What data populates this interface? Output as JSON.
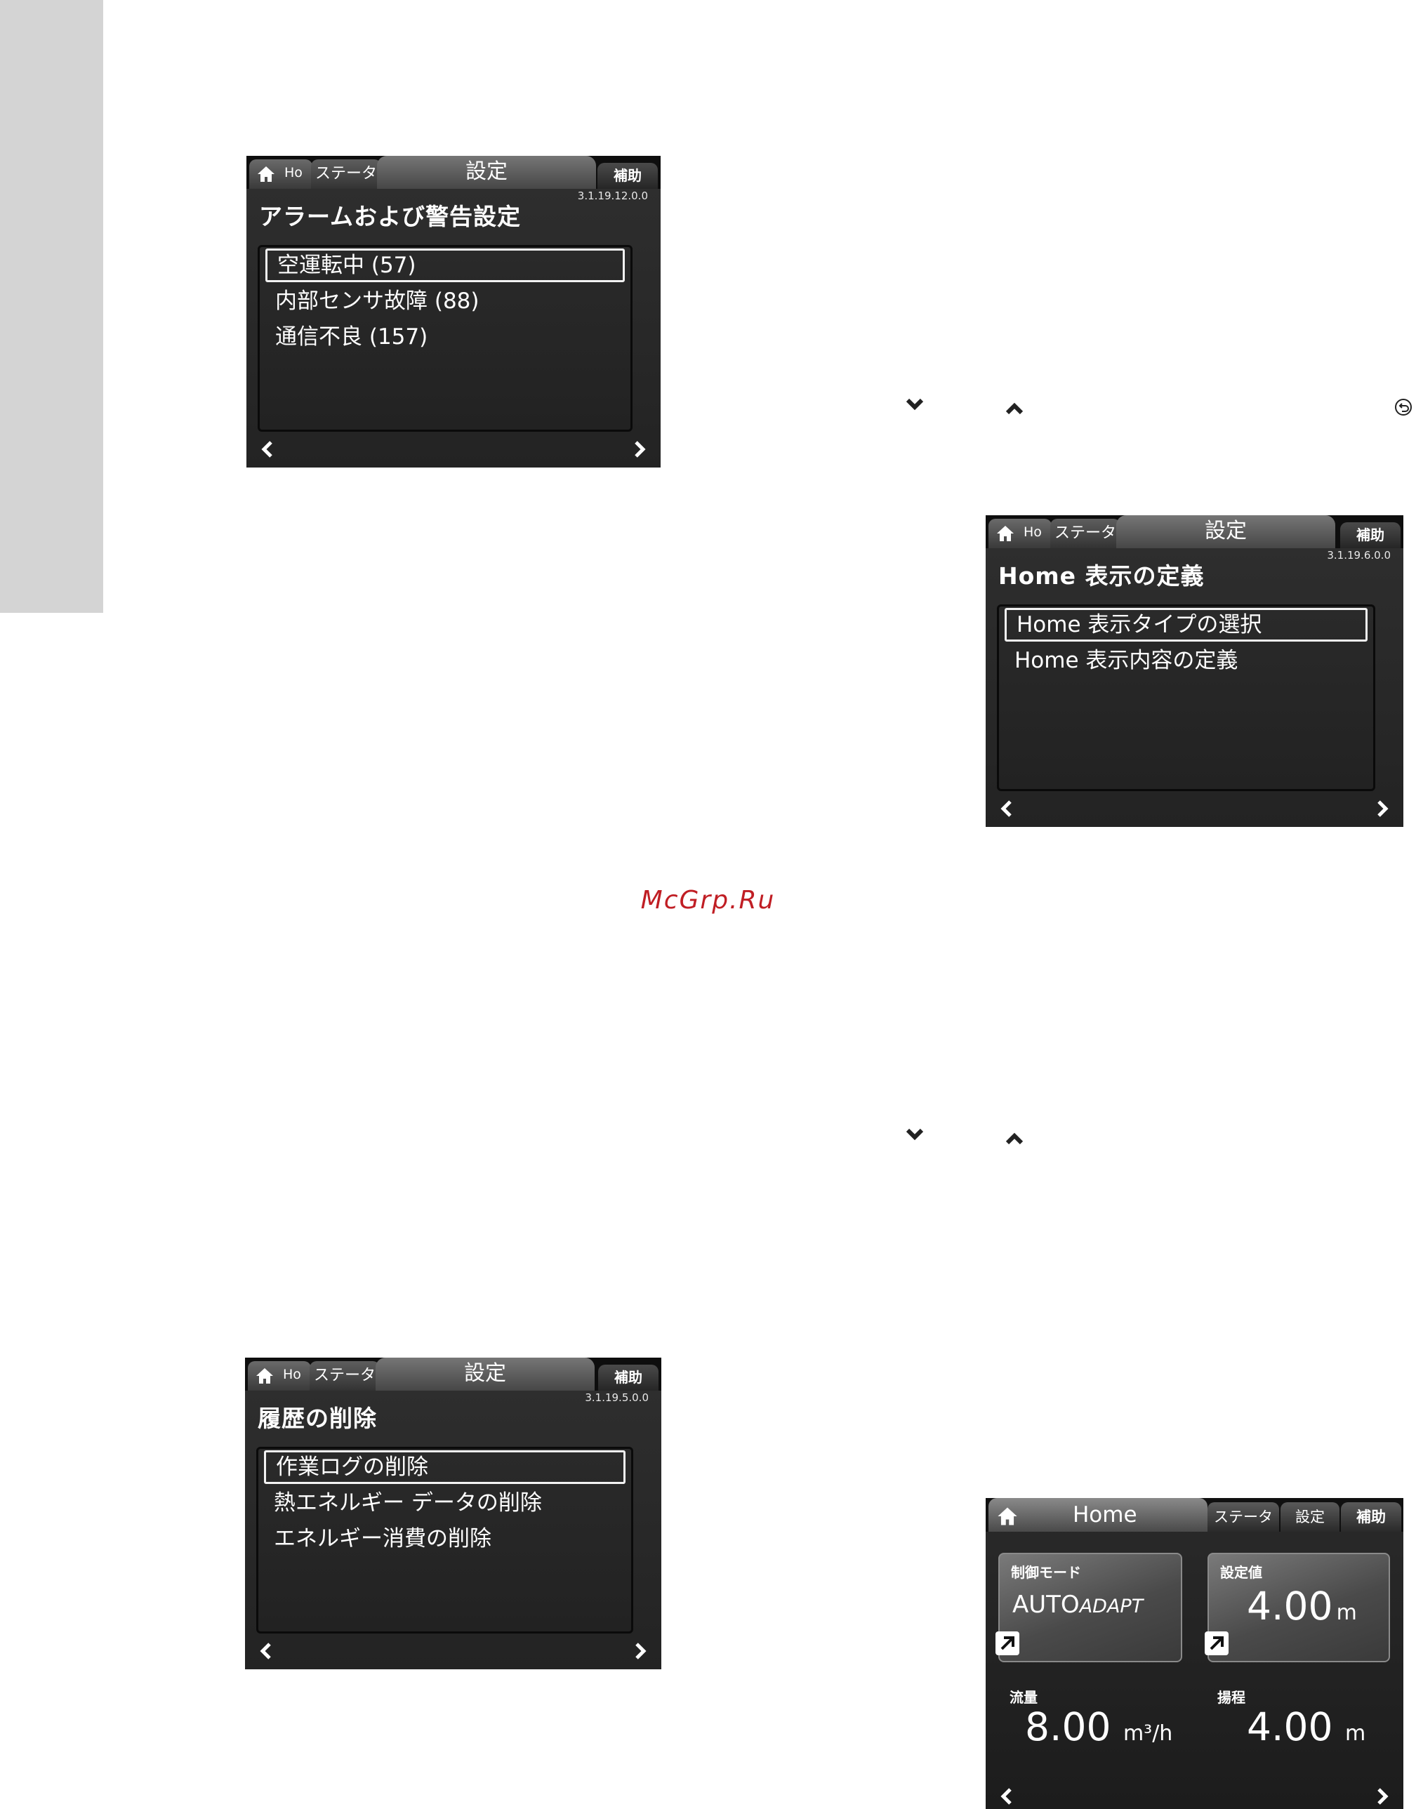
{
  "watermark": "McGrp.Ru",
  "screen1": {
    "tab_home": "Ho",
    "tab_status": "ステータ",
    "tab_settings": "設定",
    "tab_help": "補助",
    "version": "3.1.19.12.0.0",
    "title": "アラームおよび警告設定",
    "items": [
      "空運転中 (57)",
      "内部センサ故障 (88)",
      "通信不良 (157)"
    ]
  },
  "screen2": {
    "tab_home": "Ho",
    "tab_status": "ステータ",
    "tab_settings": "設定",
    "tab_help": "補助",
    "version": "3.1.19.6.0.0",
    "title": "Home 表示の定義",
    "items": [
      "Home 表示タイプの選択",
      "Home 表示内容の定義"
    ]
  },
  "screen3": {
    "tab_home": "Ho",
    "tab_status": "ステータ",
    "tab_settings": "設定",
    "tab_help": "補助",
    "version": "3.1.19.5.0.0",
    "title": "履歴の削除",
    "items": [
      "作業ログの削除",
      "熱エネルギー データの削除",
      "エネルギー消費の削除"
    ]
  },
  "home_screen": {
    "tab_home": "Home",
    "tab_status": "ステータ",
    "tab_settings": "設定",
    "tab_help": "補助",
    "control_mode_label": "制御モード",
    "control_mode_value": "AUTO",
    "control_mode_suffix": "ADAPT",
    "setpoint_label": "設定値",
    "setpoint_value": "4.00",
    "setpoint_unit": "m",
    "flow_label": "流量",
    "flow_value": "8.00",
    "flow_unit": "m³/h",
    "head_label": "揚程",
    "head_value": "4.00",
    "head_unit": "m"
  },
  "icons": {
    "down": "chevron-down-icon",
    "up": "chevron-up-icon",
    "back": "back-icon",
    "home": "home-icon",
    "left": "chevron-left-icon",
    "right": "chevron-right-icon",
    "shortcut": "shortcut-arrow-icon"
  }
}
